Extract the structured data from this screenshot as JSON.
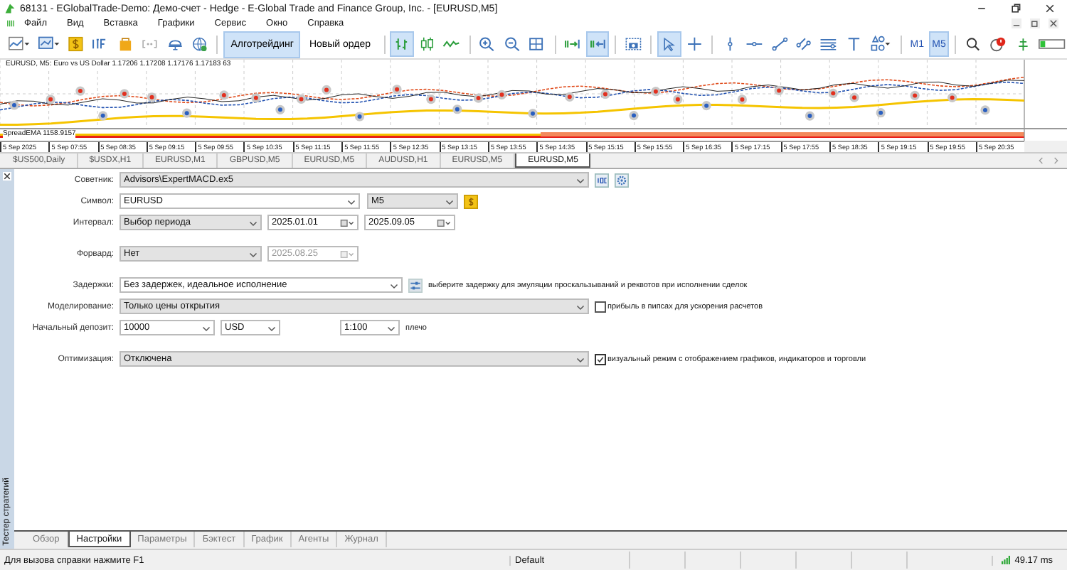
{
  "window": {
    "title": "68131 - EGlobalTrade-Demo: Демо-счет - Hedge - E-Global Trade and Finance Group, Inc. - [EURUSD,M5]"
  },
  "menu": [
    "Файл",
    "Вид",
    "Вставка",
    "Графики",
    "Сервис",
    "Окно",
    "Справка"
  ],
  "toolbar": [
    {
      "kind": "icon",
      "selected": false
    },
    {
      "kind": "icon",
      "selected": false
    },
    {
      "kind": "icon",
      "selected": false
    },
    {
      "kind": "icon",
      "selected": false
    },
    {
      "kind": "icon",
      "selected": false
    },
    {
      "kind": "icon",
      "selected": false
    },
    {
      "kind": "icon",
      "selected": false
    },
    {
      "kind": "icon",
      "selected": false
    },
    {
      "kind": "separator"
    },
    {
      "kind": "button",
      "label": "Алготрейдинг",
      "selected": true
    },
    {
      "kind": "button",
      "label": "Новый ордер",
      "selected": false
    },
    {
      "kind": "separator"
    },
    {
      "kind": "icon",
      "selected": true
    },
    {
      "kind": "icon",
      "selected": false
    },
    {
      "kind": "icon",
      "selected": false
    },
    {
      "kind": "separator"
    },
    {
      "kind": "icon",
      "selected": false
    },
    {
      "kind": "icon",
      "selected": false
    },
    {
      "kind": "icon",
      "selected": false
    },
    {
      "kind": "separator"
    },
    {
      "kind": "icon",
      "selected": false
    },
    {
      "kind": "icon",
      "selected": true
    },
    {
      "kind": "separator"
    },
    {
      "kind": "icon",
      "selected": false
    },
    {
      "kind": "separator"
    },
    {
      "kind": "icon",
      "selected": true
    },
    {
      "kind": "icon",
      "selected": false
    },
    {
      "kind": "separator"
    },
    {
      "kind": "icon",
      "selected": false
    },
    {
      "kind": "icon",
      "selected": false
    },
    {
      "kind": "icon",
      "selected": false
    },
    {
      "kind": "icon",
      "selected": false
    },
    {
      "kind": "icon",
      "selected": false
    },
    {
      "kind": "icon",
      "selected": false
    },
    {
      "kind": "icon",
      "selected": false
    },
    {
      "kind": "separator"
    },
    {
      "kind": "timeframe",
      "label": "M1",
      "selected": false
    },
    {
      "kind": "timeframe",
      "label": "M5",
      "selected": true
    },
    {
      "kind": "separator"
    },
    {
      "kind": "icon",
      "selected": false
    },
    {
      "kind": "icon",
      "selected": false
    },
    {
      "kind": "icon",
      "selected": false
    },
    {
      "kind": "icon",
      "selected": false
    }
  ],
  "chart": {
    "header": "EURUSD, M5:  Euro vs US Dollar  1.17206 1.17208 1.17176 1.17183  63",
    "indicator": "SpreadEMA 1158.9157",
    "time_labels": [
      "5 Sep 2025",
      "5 Sep 07:55",
      "5 Sep 08:35",
      "5 Sep 09:15",
      "5 Sep 09:55",
      "5 Sep 10:35",
      "5 Sep 11:15",
      "5 Sep 11:55",
      "5 Sep 12:35",
      "5 Sep 13:15",
      "5 Sep 13:55",
      "5 Sep 14:35",
      "5 Sep 15:15",
      "5 Sep 15:55",
      "5 Sep 16:35",
      "5 Sep 17:15",
      "5 Sep 17:55",
      "5 Sep 18:35",
      "5 Sep 19:15",
      "5 Sep 19:55",
      "5 Sep 20:35"
    ]
  },
  "chart_tabs": [
    {
      "label": "$US500,Daily",
      "selected": false
    },
    {
      "label": "$USDX,H1",
      "selected": false
    },
    {
      "label": "EURUSD,M1",
      "selected": false
    },
    {
      "label": "GBPUSD,M5",
      "selected": false
    },
    {
      "label": "EURUSD,M5",
      "selected": false
    },
    {
      "label": "AUDUSD,H1",
      "selected": false
    },
    {
      "label": "EURUSD,M5",
      "selected": false
    },
    {
      "label": "EURUSD,M5",
      "selected": true
    }
  ],
  "tester": {
    "side_label": "Тестер стратегий",
    "form": [
      {
        "kind": "expert",
        "label": "Советник:",
        "value": "Advisors\\ExpertMACD.ex5",
        "editable": false
      },
      {
        "kind": "symbol",
        "label": "Символ:",
        "value": "EURUSD",
        "editable": true,
        "timeframe": "M5"
      },
      {
        "kind": "interval",
        "label": "Интервал:",
        "value": "Выбор периода",
        "editable": false,
        "from": "2025.01.01",
        "to": "2025.09.05"
      },
      {
        "kind": "forward",
        "label": "Форвард:",
        "value": "Нет",
        "editable": false,
        "date": "2025.08.25",
        "date_disabled": true
      },
      {
        "kind": "delays",
        "label": "Задержки:",
        "value": "Без задержек, идеальное исполнение",
        "editable": true,
        "hint": "выберите задержку для эмуляции проскальзываний и реквотов при исполнении сделок"
      },
      {
        "kind": "modeling",
        "label": "Моделирование:",
        "value": "Только цены открытия",
        "editable": false,
        "checkbox": {
          "label": "прибыль в пипсах для ускорения расчетов",
          "checked": false
        }
      },
      {
        "kind": "deposit",
        "label": "Начальный депозит:",
        "value": "10000",
        "editable": true,
        "currency": "USD",
        "leverage": "1:100",
        "suffix": "плечо"
      },
      {
        "kind": "optimization",
        "label": "Оптимизация:",
        "value": "Отключена",
        "editable": false,
        "checkbox": {
          "label": "визуальный режим с отображением графиков, индикаторов и торговли",
          "checked": true
        }
      }
    ],
    "tabs": [
      {
        "label": "Обзор",
        "selected": false
      },
      {
        "label": "Настройки",
        "selected": true
      },
      {
        "label": "Параметры",
        "selected": false
      },
      {
        "label": "Бэктест",
        "selected": false
      },
      {
        "label": "График",
        "selected": false
      },
      {
        "label": "Агенты",
        "selected": false
      },
      {
        "label": "Журнал",
        "selected": false
      }
    ]
  },
  "status_bar": {
    "help": "Для вызова справки нажмите F1",
    "profile": "Default",
    "ping": "49.17 ms"
  }
}
